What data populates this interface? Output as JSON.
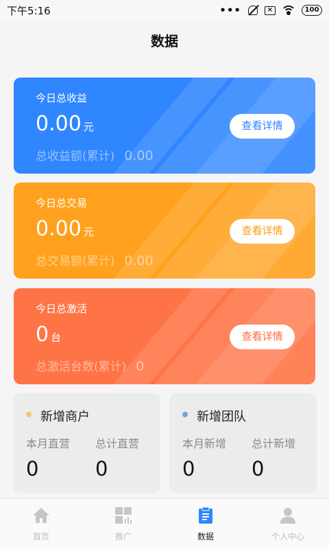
{
  "status": {
    "time": "下午5:16",
    "battery": "100"
  },
  "page_title": "数据",
  "cards": [
    {
      "label": "今日总收益",
      "value": "0.00",
      "unit": "元",
      "total_label": "总收益额(累计)",
      "total_value": "0.00",
      "button": "查看详情",
      "color": "#2f86ff"
    },
    {
      "label": "今日总交易",
      "value": "0.00",
      "unit": "元",
      "total_label": "总交易额(累计)",
      "total_value": "0.00",
      "button": "查看详情",
      "color": "#ffa11e"
    },
    {
      "label": "今日总激活",
      "value": "0",
      "unit": "台",
      "total_label": "总激活台数(累计)",
      "total_value": "0",
      "button": "查看详情",
      "color": "#ff7446"
    }
  ],
  "stats": [
    {
      "title": "新增商户",
      "col1_label": "本月直营",
      "col1_value": "0",
      "col2_label": "总计直营",
      "col2_value": "0"
    },
    {
      "title": "新增团队",
      "col1_label": "本月新增",
      "col1_value": "0",
      "col2_label": "总计新增",
      "col2_value": "0"
    }
  ],
  "tabs": [
    {
      "label": "首页",
      "icon": "home-icon"
    },
    {
      "label": "推广",
      "icon": "grid-chart-icon"
    },
    {
      "label": "数据",
      "icon": "clipboard-icon",
      "active": true
    },
    {
      "label": "个人中心",
      "icon": "user-icon"
    }
  ]
}
